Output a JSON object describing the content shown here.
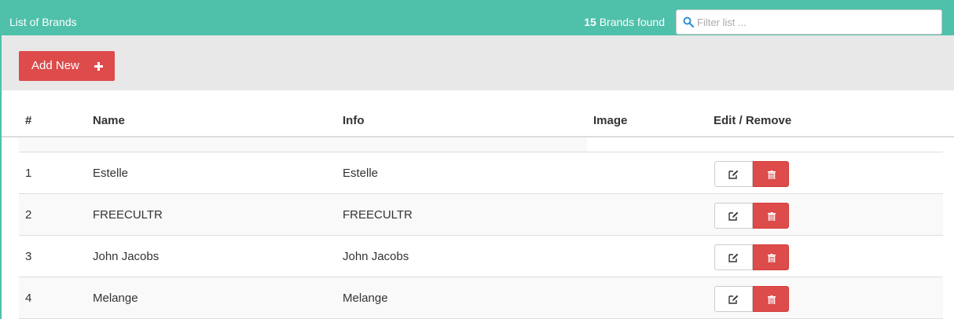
{
  "header": {
    "title": "List of Brands",
    "found_count": "15",
    "found_suffix": " Brands found",
    "filter_placeholder": "Filter list ...",
    "filter_value": ""
  },
  "toolbar": {
    "add_label": "Add New"
  },
  "table": {
    "columns": [
      "#",
      "Name",
      "Info",
      "Image",
      "Edit / Remove"
    ],
    "rows": [
      {
        "num": "1",
        "name": "Estelle",
        "info": "Estelle",
        "image": ""
      },
      {
        "num": "2",
        "name": "FREECULTR",
        "info": "FREECULTR",
        "image": ""
      },
      {
        "num": "3",
        "name": "John Jacobs",
        "info": "John Jacobs",
        "image": ""
      },
      {
        "num": "4",
        "name": "Melange",
        "info": "Melange",
        "image": ""
      }
    ]
  },
  "icons": {
    "search": "search-icon",
    "add": "plus-icon",
    "edit": "edit-icon",
    "remove": "trash-icon"
  },
  "colors": {
    "header_bg": "#4fc0a9",
    "danger": "#dd4b4b",
    "toolbar_bg": "#e8e8e8"
  }
}
